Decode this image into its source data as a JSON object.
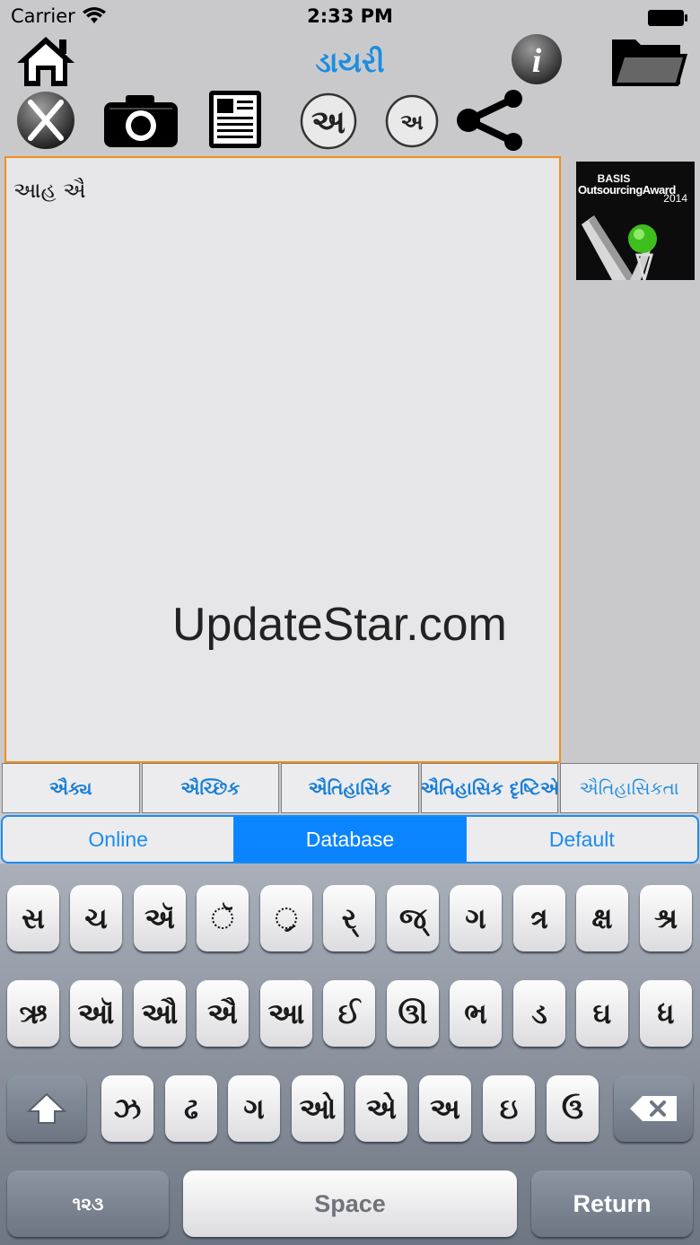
{
  "status_bar": {
    "carrier": "Carrier",
    "time": "2:33 PM"
  },
  "header": {
    "title": "ડાયરી"
  },
  "toolbar": {
    "icons": [
      "home-icon",
      "info-icon",
      "folder-icon",
      "close-icon",
      "camera-icon",
      "document-icon",
      "font-large-icon",
      "font-small-icon",
      "share-icon"
    ],
    "font_large_label": "અ",
    "font_small_label": "અ",
    "info_label": "i"
  },
  "editor": {
    "text": "આહ  ઐ",
    "watermark": "UpdateStar.com"
  },
  "award": {
    "line1": "BASIS",
    "line2": "OutsourcingAward",
    "line3": "2014"
  },
  "suggestions": [
    "ઐક્ય",
    "ઐચ્છિક",
    "ઐતિહાસિક",
    "ઐતિહાસિક દૃષ્ટિએ",
    "ઐતિહાસિકતા"
  ],
  "segments": {
    "items": [
      "Online",
      "Database",
      "Default"
    ],
    "selected": "Database"
  },
  "keyboard": {
    "row1": [
      "સ",
      "ચ",
      "ઍ",
      "ૅ",
      "્ર",
      "ર્",
      "જ્",
      "ગ",
      "ત્ર",
      "ક્ષ",
      "શ્ર"
    ],
    "row2": [
      "ઋ",
      "ઑ",
      "ઔ",
      "ઐ",
      "આ",
      "ઈ",
      "ઊ",
      "ભ",
      "ડ",
      "ઘ",
      "ધ"
    ],
    "row3": [
      "ઝ",
      "ઢ",
      "ગ",
      "ઓ",
      "એ",
      "અ",
      "ઇ",
      "ઉ"
    ],
    "numbers_label": "૧૨૩",
    "space_label": "Space",
    "return_label": "Return"
  },
  "colors": {
    "accent": "#1a8cf0",
    "title": "#1a8de0",
    "editor_border": "#f0901a",
    "suggestion_text": "#1a7fd6"
  }
}
